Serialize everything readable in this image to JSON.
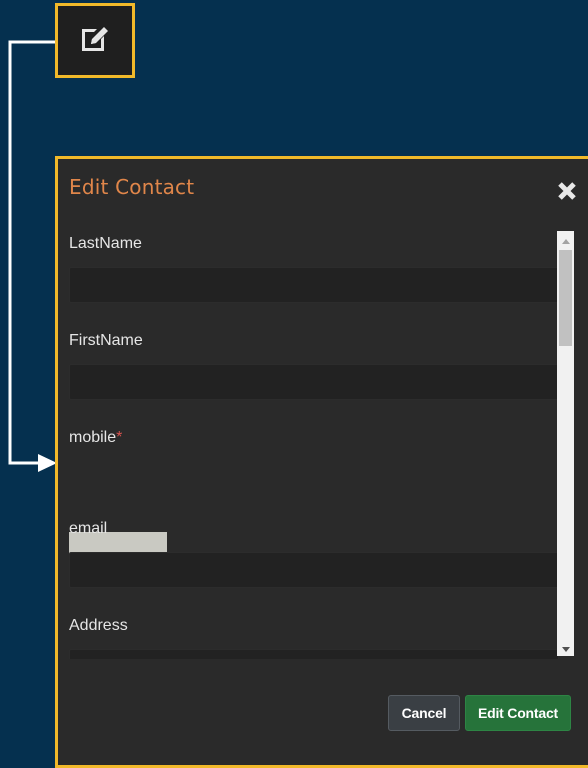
{
  "trigger": {
    "icon": "edit-icon",
    "accent_color": "#f1b92a"
  },
  "modal": {
    "title": "Edit Contact",
    "close_icon": "close-icon",
    "title_color": "#e0864a",
    "fields": [
      {
        "label": "LastName",
        "value": ""
      },
      {
        "label": "FirstName",
        "value": ""
      },
      {
        "label": "mobile",
        "required_mark": "*",
        "value": ""
      },
      {
        "label": "email",
        "value": ""
      },
      {
        "label": "Address",
        "value": ""
      }
    ],
    "buttons": {
      "cancel_label": "Cancel",
      "submit_label": "Edit Contact"
    }
  },
  "colors": {
    "background": "#05304f",
    "highlight_border": "#f1b92a",
    "modal_bg": "#2a2a2a",
    "submit_green": "#26733a",
    "required_red": "#d9534f"
  }
}
